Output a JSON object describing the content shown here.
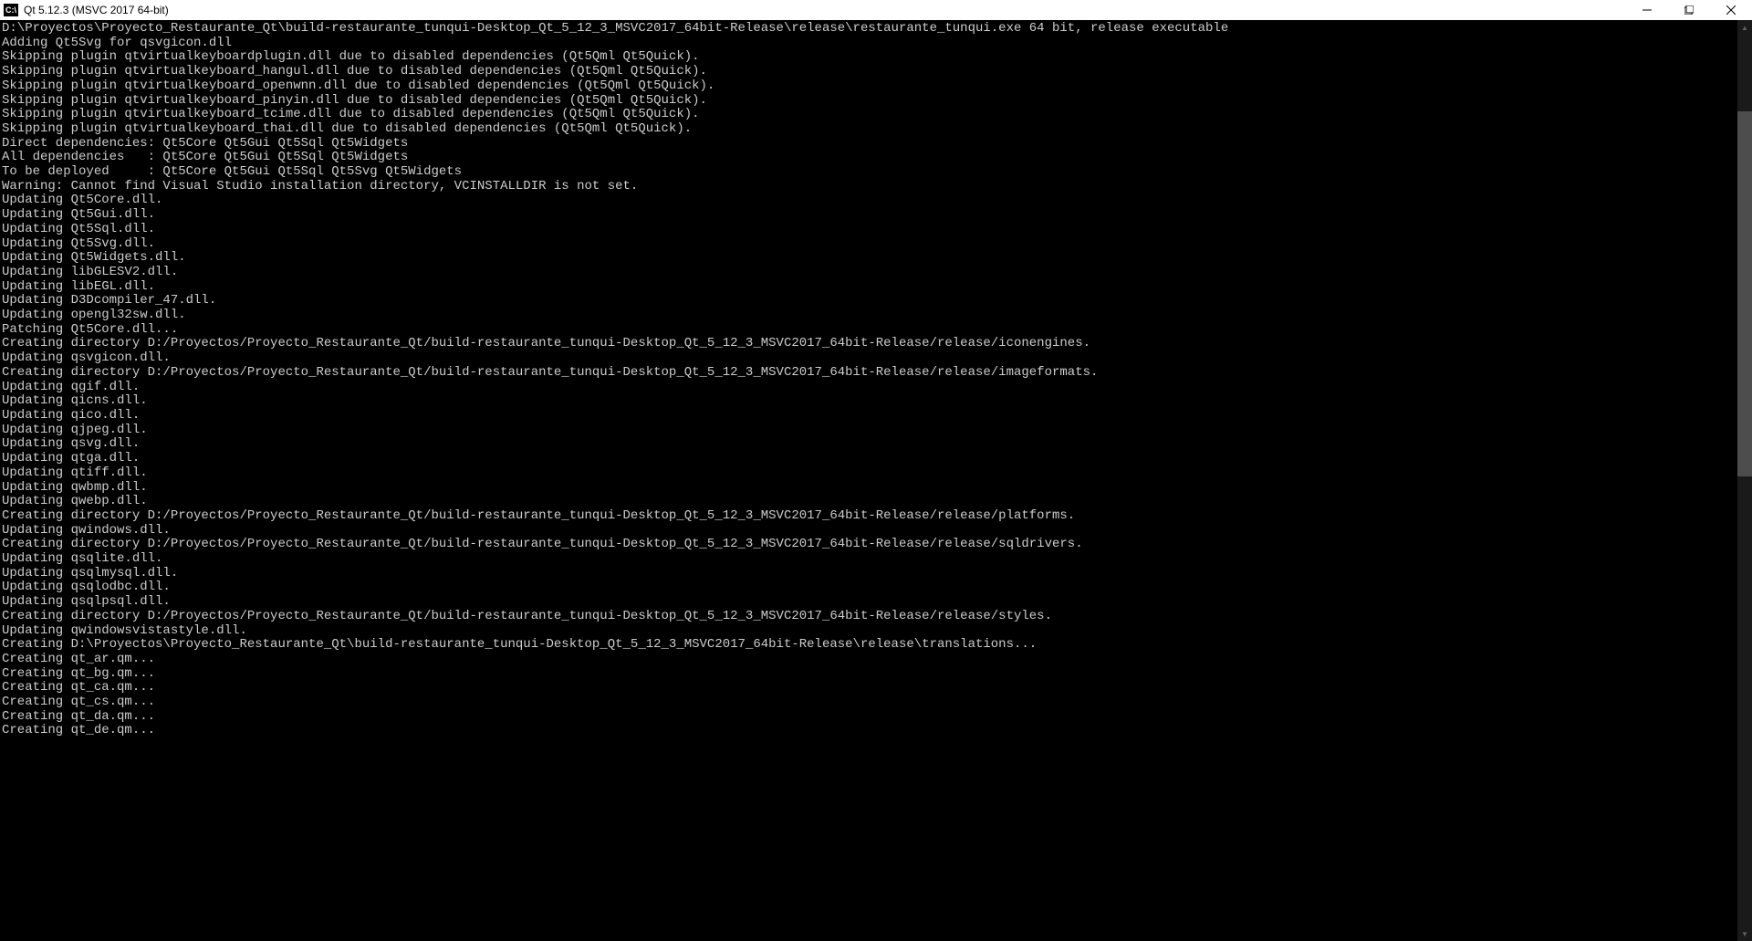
{
  "titlebar": {
    "icon_label": "C:\\",
    "title": "Qt 5.12.3 (MSVC 2017 64-bit)"
  },
  "console": {
    "lines": [
      "D:\\Proyectos\\Proyecto_Restaurante_Qt\\build-restaurante_tunqui-Desktop_Qt_5_12_3_MSVC2017_64bit-Release\\release\\restaurante_tunqui.exe 64 bit, release executable",
      "Adding Qt5Svg for qsvgicon.dll",
      "Skipping plugin qtvirtualkeyboardplugin.dll due to disabled dependencies (Qt5Qml Qt5Quick).",
      "Skipping plugin qtvirtualkeyboard_hangul.dll due to disabled dependencies (Qt5Qml Qt5Quick).",
      "Skipping plugin qtvirtualkeyboard_openwnn.dll due to disabled dependencies (Qt5Qml Qt5Quick).",
      "Skipping plugin qtvirtualkeyboard_pinyin.dll due to disabled dependencies (Qt5Qml Qt5Quick).",
      "Skipping plugin qtvirtualkeyboard_tcime.dll due to disabled dependencies (Qt5Qml Qt5Quick).",
      "Skipping plugin qtvirtualkeyboard_thai.dll due to disabled dependencies (Qt5Qml Qt5Quick).",
      "Direct dependencies: Qt5Core Qt5Gui Qt5Sql Qt5Widgets",
      "All dependencies   : Qt5Core Qt5Gui Qt5Sql Qt5Widgets",
      "To be deployed     : Qt5Core Qt5Gui Qt5Sql Qt5Svg Qt5Widgets",
      "Warning: Cannot find Visual Studio installation directory, VCINSTALLDIR is not set.",
      "Updating Qt5Core.dll.",
      "Updating Qt5Gui.dll.",
      "Updating Qt5Sql.dll.",
      "Updating Qt5Svg.dll.",
      "Updating Qt5Widgets.dll.",
      "Updating libGLESV2.dll.",
      "Updating libEGL.dll.",
      "Updating D3Dcompiler_47.dll.",
      "Updating opengl32sw.dll.",
      "Patching Qt5Core.dll...",
      "Creating directory D:/Proyectos/Proyecto_Restaurante_Qt/build-restaurante_tunqui-Desktop_Qt_5_12_3_MSVC2017_64bit-Release/release/iconengines.",
      "Updating qsvgicon.dll.",
      "Creating directory D:/Proyectos/Proyecto_Restaurante_Qt/build-restaurante_tunqui-Desktop_Qt_5_12_3_MSVC2017_64bit-Release/release/imageformats.",
      "Updating qgif.dll.",
      "Updating qicns.dll.",
      "Updating qico.dll.",
      "Updating qjpeg.dll.",
      "Updating qsvg.dll.",
      "Updating qtga.dll.",
      "Updating qtiff.dll.",
      "Updating qwbmp.dll.",
      "Updating qwebp.dll.",
      "Creating directory D:/Proyectos/Proyecto_Restaurante_Qt/build-restaurante_tunqui-Desktop_Qt_5_12_3_MSVC2017_64bit-Release/release/platforms.",
      "Updating qwindows.dll.",
      "Creating directory D:/Proyectos/Proyecto_Restaurante_Qt/build-restaurante_tunqui-Desktop_Qt_5_12_3_MSVC2017_64bit-Release/release/sqldrivers.",
      "Updating qsqlite.dll.",
      "Updating qsqlmysql.dll.",
      "Updating qsqlodbc.dll.",
      "Updating qsqlpsql.dll.",
      "Creating directory D:/Proyectos/Proyecto_Restaurante_Qt/build-restaurante_tunqui-Desktop_Qt_5_12_3_MSVC2017_64bit-Release/release/styles.",
      "Updating qwindowsvistastyle.dll.",
      "Creating D:\\Proyectos\\Proyecto_Restaurante_Qt\\build-restaurante_tunqui-Desktop_Qt_5_12_3_MSVC2017_64bit-Release\\release\\translations...",
      "Creating qt_ar.qm...",
      "Creating qt_bg.qm...",
      "Creating qt_ca.qm...",
      "Creating qt_cs.qm...",
      "Creating qt_da.qm...",
      "Creating qt_de.qm..."
    ]
  }
}
